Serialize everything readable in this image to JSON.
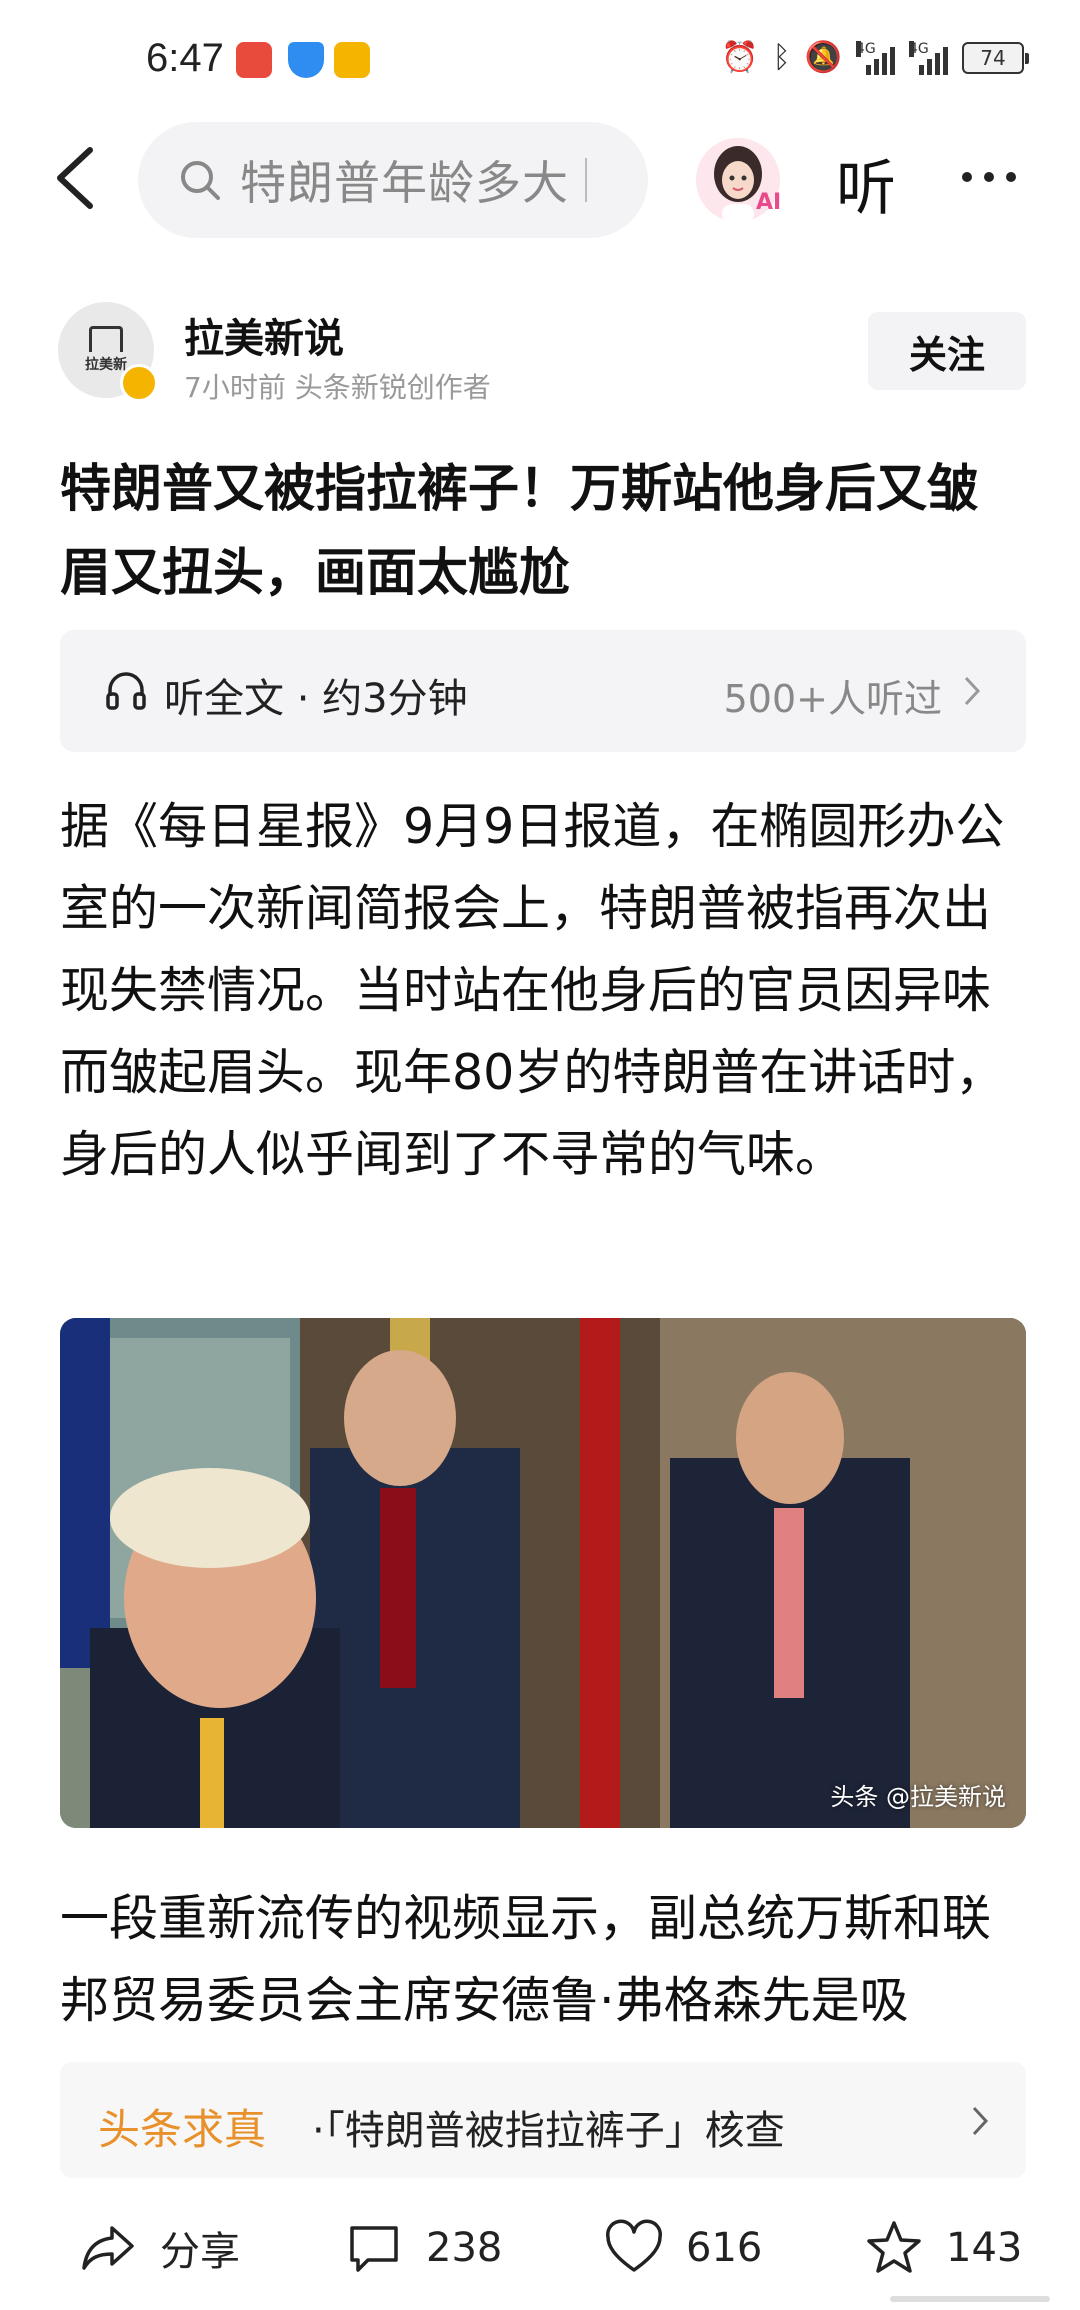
{
  "status_bar": {
    "time": "6:47",
    "network_1": "4G",
    "network_2": "4G",
    "battery": "74"
  },
  "top_nav": {
    "search_text": "特朗普年龄多大",
    "listen_label": "听",
    "ai_badge": "AI"
  },
  "author": {
    "avatar_label": "拉美新",
    "name": "拉美新说",
    "meta": "7小时前 头条新锐创作者",
    "follow_label": "关注"
  },
  "article": {
    "title": "特朗普又被指拉裤子！万斯站他身后又皱眉又扭头，画面太尴尬",
    "listen_bar": {
      "label": "听全文 · 约3分钟",
      "count": "500+人听过"
    },
    "paragraph_1": "据《每日星报》9月9日报道，在椭圆形办公室的一次新闻简报会上，特朗普被指再次出现失禁情况。当时站在他身后的官员因异味而皱起眉头。现年80岁的特朗普在讲话时，身后的人似乎闻到了不寻常的气味。",
    "image_watermark": "头条 @拉美新说",
    "paragraph_2": "一段重新流传的视频显示，副总统万斯和联邦贸易委员会主席安德鲁·弗格森先是吸"
  },
  "fact_check": {
    "tag": "头条求真",
    "text": "·「特朗普被指拉裤子」核查"
  },
  "actions": {
    "share_label": "分享",
    "comments": "238",
    "likes": "616",
    "favorites": "143"
  },
  "colors": {
    "fact_tag": "#e8902a",
    "muted": "#888888",
    "panel_bg": "#f4f4f6"
  }
}
